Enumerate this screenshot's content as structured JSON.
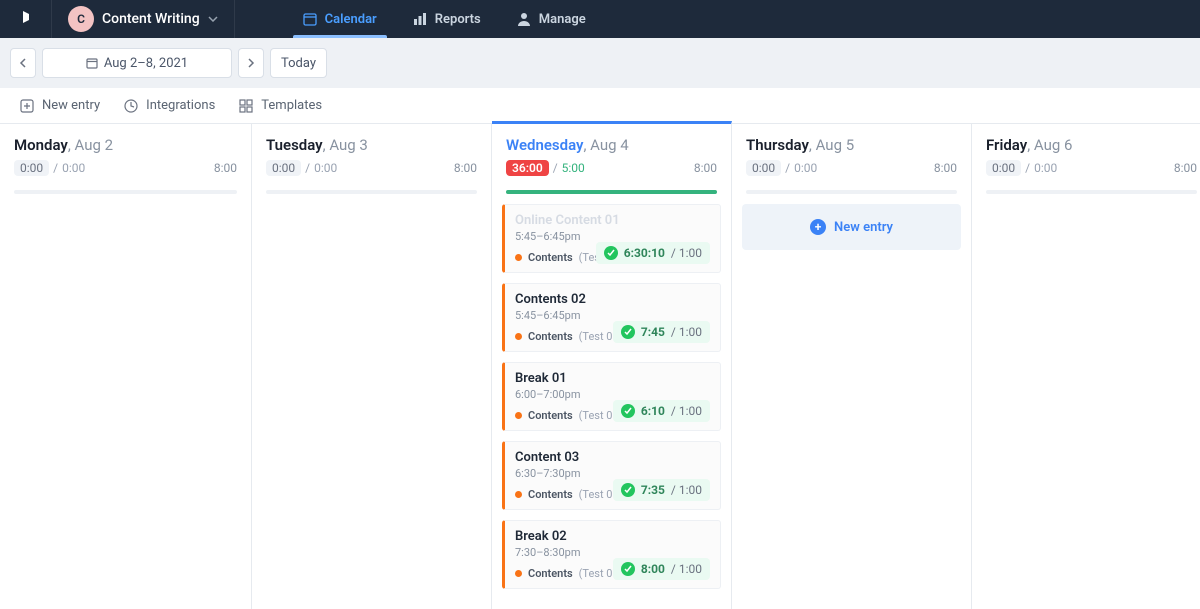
{
  "header": {
    "project_initial": "C",
    "project_name": "Content Writing",
    "tabs": {
      "calendar": "Calendar",
      "reports": "Reports",
      "manage": "Manage"
    }
  },
  "datebar": {
    "range": "Aug 2–8, 2021",
    "today": "Today"
  },
  "toolbar": {
    "new_entry": "New entry",
    "integrations": "Integrations",
    "templates": "Templates"
  },
  "days": [
    {
      "weekday": "Monday",
      "date": "Aug 2",
      "current": false,
      "tracked": "0:00",
      "actual": "0:00",
      "planned": "8:00",
      "fill": 0,
      "entries": []
    },
    {
      "weekday": "Tuesday",
      "date": "Aug 3",
      "current": false,
      "tracked": "0:00",
      "actual": "0:00",
      "planned": "8:00",
      "fill": 0,
      "entries": []
    },
    {
      "weekday": "Wednesday",
      "date": "Aug 4",
      "current": true,
      "tracked": "36:00",
      "actual": "5:00",
      "planned": "8:00",
      "fill": 100,
      "entries": [
        {
          "title": "Online Content 01",
          "ghost": true,
          "time": "5:45–6:45pm",
          "project": "Contents",
          "paren": "(Test 01)",
          "elapsed": "6:30:10",
          "plan": "1:00"
        },
        {
          "title": "Contents 02",
          "ghost": false,
          "time": "5:45–6:45pm",
          "project": "Contents",
          "paren": "(Test 01)",
          "elapsed": "7:45",
          "plan": "1:00"
        },
        {
          "title": "Break 01",
          "ghost": false,
          "time": "6:00–7:00pm",
          "project": "Contents",
          "paren": "(Test 01)",
          "elapsed": "6:10",
          "plan": "1:00"
        },
        {
          "title": "Content 03",
          "ghost": false,
          "time": "6:30–7:30pm",
          "project": "Contents",
          "paren": "(Test 01)",
          "elapsed": "7:35",
          "plan": "1:00"
        },
        {
          "title": "Break 02",
          "ghost": false,
          "time": "7:30–8:30pm",
          "project": "Contents",
          "paren": "(Test 01)",
          "elapsed": "8:00",
          "plan": "1:00"
        }
      ]
    },
    {
      "weekday": "Thursday",
      "date": "Aug 5",
      "current": false,
      "tracked": "0:00",
      "actual": "0:00",
      "planned": "8:00",
      "fill": 0,
      "entries": "new"
    },
    {
      "weekday": "Friday",
      "date": "Aug 6",
      "current": false,
      "tracked": "0:00",
      "actual": "0:00",
      "planned": "8:00",
      "fill": 0,
      "entries": []
    }
  ],
  "labels": {
    "new_entry_card": "New entry"
  }
}
